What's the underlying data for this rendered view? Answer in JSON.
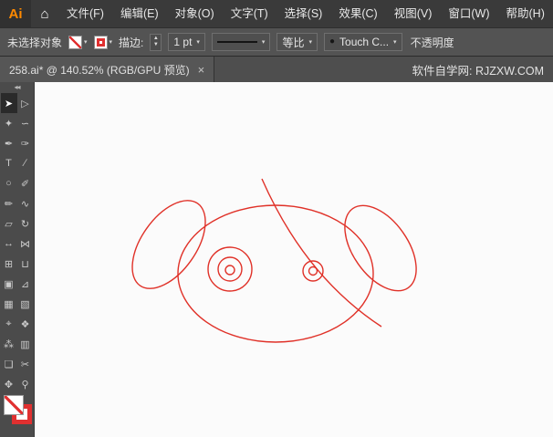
{
  "app": {
    "logo": "Ai"
  },
  "icons": {
    "home": "⌂",
    "dropdown": "▾",
    "up": "▲",
    "down": "▼",
    "brush_dot": "●"
  },
  "menubar": {
    "items": [
      {
        "key": "file",
        "label": "文件(F)"
      },
      {
        "key": "edit",
        "label": "编辑(E)"
      },
      {
        "key": "object",
        "label": "对象(O)"
      },
      {
        "key": "type",
        "label": "文字(T)"
      },
      {
        "key": "select",
        "label": "选择(S)"
      },
      {
        "key": "effect",
        "label": "效果(C)"
      },
      {
        "key": "view",
        "label": "视图(V)"
      },
      {
        "key": "window",
        "label": "窗口(W)"
      },
      {
        "key": "help",
        "label": "帮助(H)"
      }
    ]
  },
  "controlbar": {
    "status": "未选择对象",
    "stroke_label": "描边:",
    "stroke_weight": "1 pt",
    "proportional": "等比",
    "brush": "Touch C...",
    "opacity_label": "不透明度"
  },
  "tab": {
    "title": "258.ai* @ 140.52% (RGB/GPU 预览)",
    "close": "×",
    "site": "软件自学网: RJZXW.COM"
  },
  "toolbar": {
    "collapse": "◂◂",
    "tools": [
      {
        "name": "selection-tool",
        "glyph": "➤",
        "active": true
      },
      {
        "name": "direct-selection-tool",
        "glyph": "▷",
        "active": false
      },
      {
        "name": "magic-wand-tool",
        "glyph": "✦",
        "active": false
      },
      {
        "name": "lasso-tool",
        "glyph": "∽",
        "active": false
      },
      {
        "name": "pen-tool",
        "glyph": "✒",
        "active": false
      },
      {
        "name": "curvature-tool",
        "glyph": "✑",
        "active": false
      },
      {
        "name": "type-tool",
        "glyph": "T",
        "active": false
      },
      {
        "name": "line-segment-tool",
        "glyph": "∕",
        "active": false
      },
      {
        "name": "ellipse-tool",
        "glyph": "○",
        "active": false
      },
      {
        "name": "paintbrush-tool",
        "glyph": "✐",
        "active": false
      },
      {
        "name": "pencil-tool",
        "glyph": "✏",
        "active": false
      },
      {
        "name": "shaper-tool",
        "glyph": "∿",
        "active": false
      },
      {
        "name": "eraser-tool",
        "glyph": "▱",
        "active": false
      },
      {
        "name": "rotate-tool",
        "glyph": "↻",
        "active": false
      },
      {
        "name": "scale-tool",
        "glyph": "↔",
        "active": false
      },
      {
        "name": "width-tool",
        "glyph": "⋈",
        "active": false
      },
      {
        "name": "free-transform-tool",
        "glyph": "⊞",
        "active": false
      },
      {
        "name": "shape-builder-tool",
        "glyph": "⊔",
        "active": false
      },
      {
        "name": "live-paint-bucket-tool",
        "glyph": "▣",
        "active": false
      },
      {
        "name": "perspective-grid-tool",
        "glyph": "⊿",
        "active": false
      },
      {
        "name": "mesh-tool",
        "glyph": "▦",
        "active": false
      },
      {
        "name": "gradient-tool",
        "glyph": "▧",
        "active": false
      },
      {
        "name": "eyedropper-tool",
        "glyph": "⌖",
        "active": false
      },
      {
        "name": "blend-tool",
        "glyph": "❖",
        "active": false
      },
      {
        "name": "symbol-sprayer-tool",
        "glyph": "⁂",
        "active": false
      },
      {
        "name": "column-graph-tool",
        "glyph": "▥",
        "active": false
      },
      {
        "name": "artboard-tool",
        "glyph": "❏",
        "active": false
      },
      {
        "name": "slice-tool",
        "glyph": "✂",
        "active": false
      },
      {
        "name": "hand-tool",
        "glyph": "✥",
        "active": false
      },
      {
        "name": "zoom-tool",
        "glyph": "⚲",
        "active": false
      }
    ]
  },
  "artwork": {
    "description": "red outline sketch of dog head: two ears, head ellipse, two eyes, diagonal construction line",
    "stroke_color": "#e03128"
  }
}
